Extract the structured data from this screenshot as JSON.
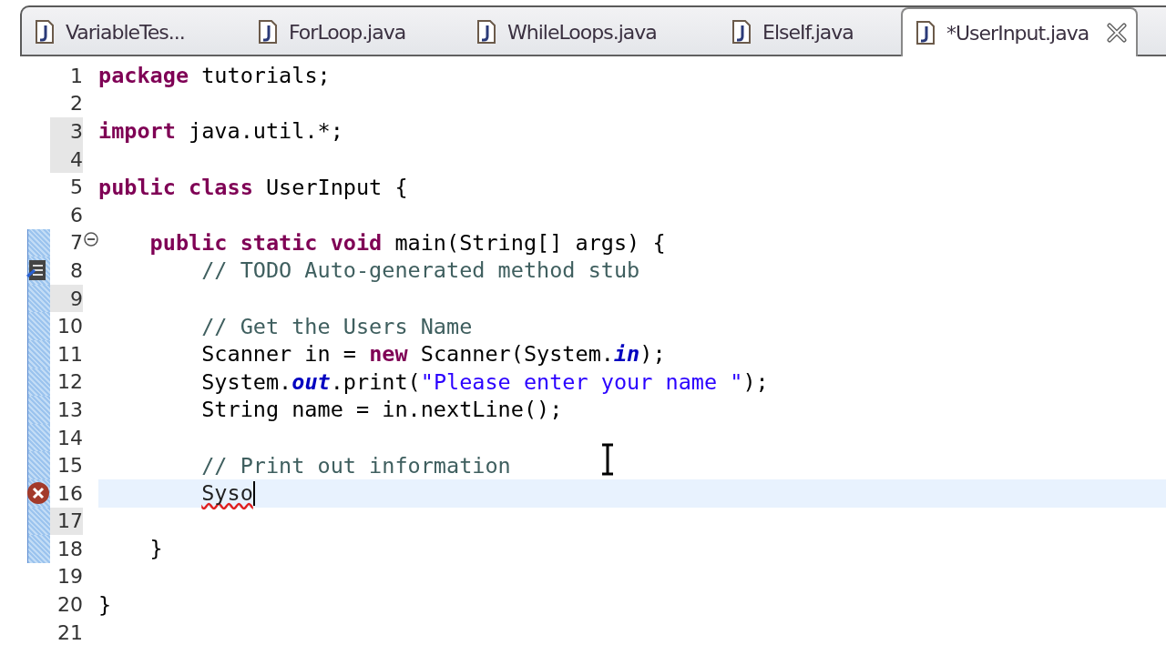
{
  "tabs": [
    {
      "label": "VariableTes...",
      "selected": false
    },
    {
      "label": "ForLoop.java",
      "selected": false
    },
    {
      "label": "WhileLoops.java",
      "selected": false
    },
    {
      "label": "ElseIf.java",
      "selected": false
    },
    {
      "label": "*UserInput.java",
      "selected": true
    }
  ],
  "editor": {
    "lines": [
      {
        "number": "1",
        "kind": "plain",
        "shaded": false,
        "changed": false,
        "current": false,
        "tokens": [
          {
            "kind": "keyword",
            "text": "package"
          },
          {
            "kind": "plain",
            "text": " tutorials;"
          }
        ]
      },
      {
        "number": "2",
        "kind": "plain",
        "shaded": false,
        "changed": false,
        "current": false
      },
      {
        "number": "3",
        "kind": "plain",
        "shaded": true,
        "changed": false,
        "current": false,
        "tokens": [
          {
            "kind": "keyword",
            "text": "import"
          },
          {
            "kind": "plain",
            "text": " java.util.*;"
          }
        ]
      },
      {
        "number": "4",
        "kind": "plain",
        "shaded": true,
        "changed": false,
        "current": false
      },
      {
        "number": "5",
        "kind": "plain",
        "shaded": false,
        "changed": false,
        "current": false,
        "tokens": [
          {
            "kind": "keyword",
            "text": "public class"
          },
          {
            "kind": "plain",
            "text": " UserInput {"
          }
        ]
      },
      {
        "number": "6",
        "kind": "plain",
        "shaded": false,
        "changed": false,
        "current": false
      },
      {
        "number": "7",
        "kind": "fold",
        "shaded": false,
        "changed": true,
        "current": false,
        "tokens": [
          {
            "kind": "keyword",
            "text": "    public static void"
          },
          {
            "kind": "plain",
            "text": " main(String[] args) {"
          }
        ]
      },
      {
        "number": "8",
        "kind": "task",
        "shaded": false,
        "changed": true,
        "current": false,
        "tokens": [
          {
            "kind": "comment",
            "text": "        // TODO Auto-generated method stub"
          }
        ]
      },
      {
        "number": "9",
        "kind": "plain",
        "shaded": true,
        "changed": true,
        "current": false
      },
      {
        "number": "10",
        "kind": "plain",
        "shaded": false,
        "changed": true,
        "current": false,
        "tokens": [
          {
            "kind": "comment",
            "text": "        // Get the Users Name"
          }
        ]
      },
      {
        "number": "11",
        "kind": "plain",
        "shaded": false,
        "changed": true,
        "current": false,
        "tokens": [
          {
            "kind": "plain",
            "text": "        Scanner in = "
          },
          {
            "kind": "keyword",
            "text": "new"
          },
          {
            "kind": "plain",
            "text": " Scanner(System."
          },
          {
            "kind": "static-field",
            "text": "in"
          },
          {
            "kind": "plain",
            "text": ");"
          }
        ]
      },
      {
        "number": "12",
        "kind": "plain",
        "shaded": false,
        "changed": true,
        "current": false,
        "tokens": [
          {
            "kind": "plain",
            "text": "        System."
          },
          {
            "kind": "static-field",
            "text": "out"
          },
          {
            "kind": "plain",
            "text": ".print("
          },
          {
            "kind": "string",
            "text": "\"Please enter your name \""
          },
          {
            "kind": "plain",
            "text": ");"
          }
        ]
      },
      {
        "number": "13",
        "kind": "plain",
        "shaded": false,
        "changed": true,
        "current": false,
        "tokens": [
          {
            "kind": "plain",
            "text": "        String name = in.nextLine();"
          }
        ]
      },
      {
        "number": "14",
        "kind": "plain",
        "shaded": false,
        "changed": true,
        "current": false
      },
      {
        "number": "15",
        "kind": "plain",
        "shaded": false,
        "changed": true,
        "current": false,
        "tokens": [
          {
            "kind": "comment",
            "text": "        // Print out information"
          }
        ]
      },
      {
        "number": "16",
        "kind": "error",
        "shaded": false,
        "changed": true,
        "current": true,
        "tokens": [
          {
            "kind": "error",
            "text": "        Syso"
          }
        ]
      },
      {
        "number": "17",
        "kind": "plain",
        "shaded": true,
        "changed": true,
        "current": false
      },
      {
        "number": "18",
        "kind": "plain",
        "shaded": false,
        "changed": true,
        "current": false,
        "tokens": [
          {
            "kind": "plain",
            "text": "    }"
          }
        ]
      },
      {
        "number": "19",
        "kind": "plain",
        "shaded": false,
        "changed": false,
        "current": false
      },
      {
        "number": "20",
        "kind": "plain",
        "shaded": false,
        "changed": false,
        "current": false,
        "tokens": [
          {
            "kind": "plain",
            "text": "}"
          }
        ]
      },
      {
        "number": "21",
        "kind": "plain",
        "shaded": false,
        "changed": false,
        "current": false
      }
    ]
  }
}
